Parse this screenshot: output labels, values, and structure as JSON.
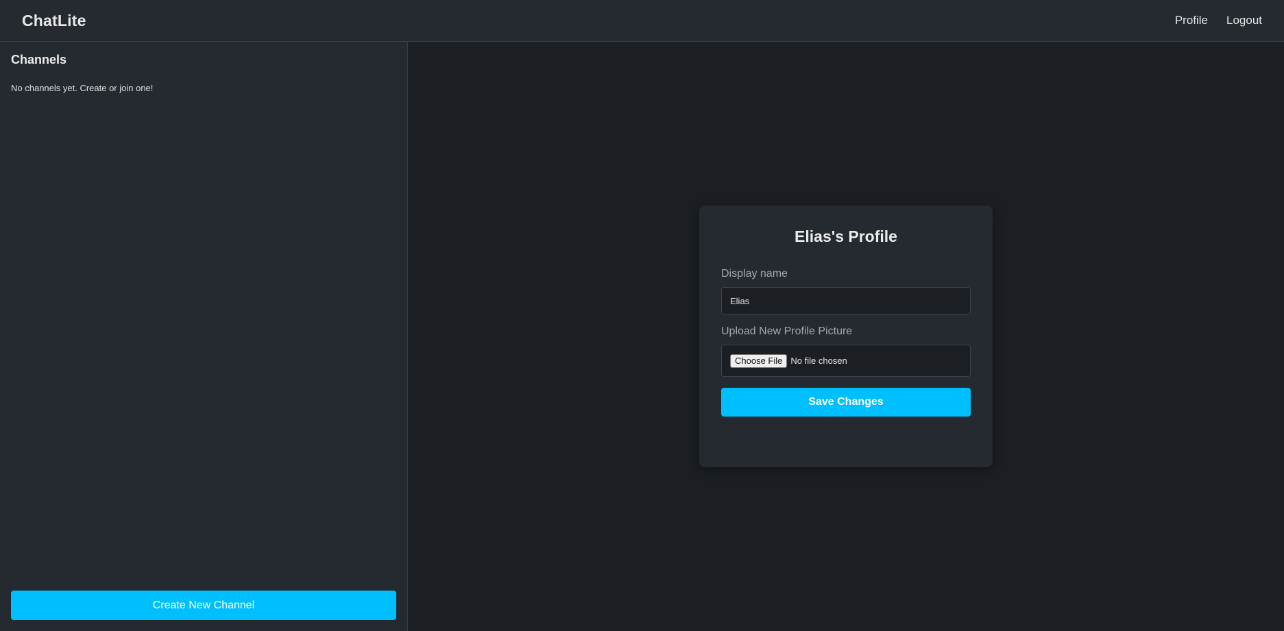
{
  "header": {
    "brand": "ChatLite",
    "nav": {
      "profile": "Profile",
      "logout": "Logout"
    }
  },
  "sidebar": {
    "title": "Channels",
    "empty_message": "No channels yet. Create or join one!",
    "create_button": "Create New Channel"
  },
  "profile_card": {
    "title": "Elias's Profile",
    "display_name_label": "Display name",
    "display_name_value": "Elias",
    "upload_label": "Upload New Profile Picture",
    "file_button": "Choose File",
    "file_status": "No file chosen",
    "save_button": "Save Changes"
  },
  "colors": {
    "accent": "#00bfff",
    "panel": "#252930",
    "background": "#1b1e22"
  }
}
